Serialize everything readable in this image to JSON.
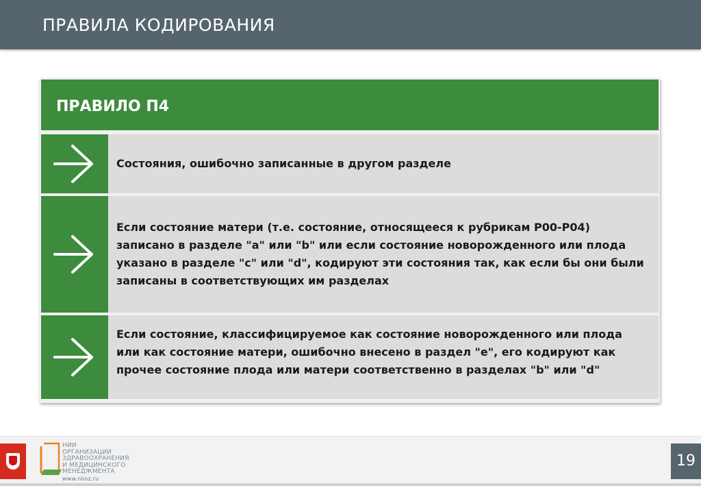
{
  "header": {
    "title": "ПРАВИЛА КОДИРОВАНИЯ"
  },
  "rule": {
    "title": "ПРАВИЛО П4",
    "items": [
      {
        "text": "Состояния, ошибочно записанные в другом разделе"
      },
      {
        "text": "Если состояние матери (т.е. состояние, относящееся к рубрикам Р00-Р04) записано в разделе \"а\" или \"b\" или если состояние новорожденного или плода указано в разделе \"с\" или \"d\", кодируют эти  состояния так, как если бы они были записаны в соответствующих им разделах"
      },
      {
        "text": "Если состояние, классифицируемое как состояние новорожденного или  плода или как состояние матери, ошибочно внесено в раздел \"е\", его кодируют как прочее состояние плода или матери соответственно в разделах \"b\" или \"d\""
      }
    ]
  },
  "footer": {
    "org_lines": [
      "НИИ",
      "ОРГАНИЗАЦИИ",
      "ЗДРАВООХРАНЕНИЯ",
      "И МЕДИЦИНСКОГО",
      "МЕНЕДЖМЕНТА"
    ],
    "site": "www.niioz.ru",
    "page_number": "19"
  },
  "colors": {
    "header_bg": "#56646d",
    "green": "#3d8b3d",
    "row_bg": "#dcdcdc",
    "emblem_red": "#d52b1e"
  }
}
